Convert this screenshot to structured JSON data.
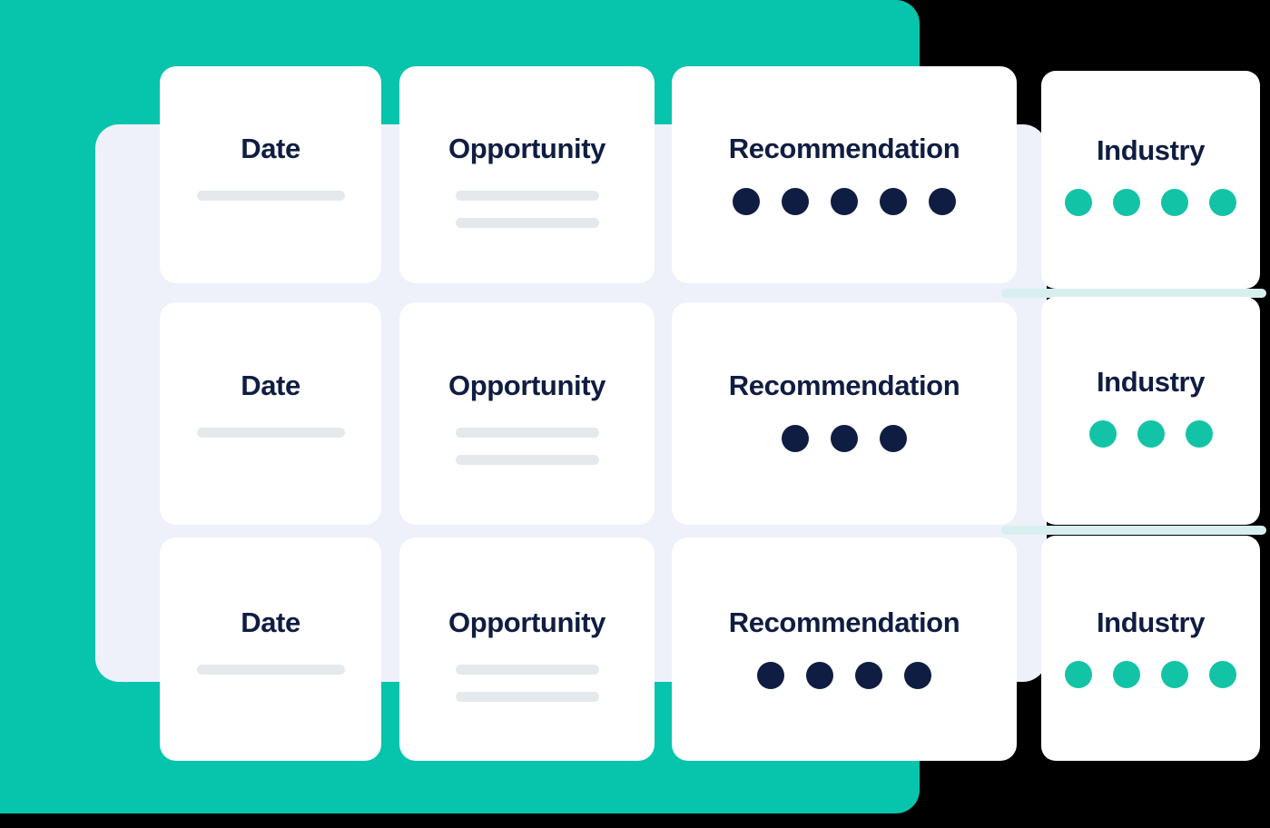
{
  "theme": {
    "page_background": "#000000",
    "panel_teal": "#07c4ad",
    "panel_lavender": "#eef1fa",
    "card_white": "#ffffff",
    "heading_navy": "#101d42",
    "dot_navy": "#101d42",
    "dot_teal": "#12c4a5",
    "skeleton_grey": "#e5e9ec",
    "rule_mint": "#d8eff0"
  },
  "columns": {
    "date": "Date",
    "opportunity": "Opportunity",
    "recommendation": "Recommendation",
    "industry": "Industry"
  },
  "rows": [
    {
      "date": {
        "label": "Date",
        "skeleton_bars": 1
      },
      "opportunity": {
        "label": "Opportunity",
        "skeleton_bars": 2
      },
      "recommendation": {
        "label": "Recommendation",
        "dots": 5,
        "dot_color": "#101d42"
      },
      "industry": {
        "label": "Industry",
        "dots": 4,
        "dot_color": "#12c4a5"
      }
    },
    {
      "date": {
        "label": "Date",
        "skeleton_bars": 1
      },
      "opportunity": {
        "label": "Opportunity",
        "skeleton_bars": 2
      },
      "recommendation": {
        "label": "Recommendation",
        "dots": 3,
        "dot_color": "#101d42"
      },
      "industry": {
        "label": "Industry",
        "dots": 3,
        "dot_color": "#12c4a5"
      }
    },
    {
      "date": {
        "label": "Date",
        "skeleton_bars": 1
      },
      "opportunity": {
        "label": "Opportunity",
        "skeleton_bars": 2
      },
      "recommendation": {
        "label": "Recommendation",
        "dots": 4,
        "dot_color": "#101d42"
      },
      "industry": {
        "label": "Industry",
        "dots": 4,
        "dot_color": "#12c4a5"
      }
    }
  ]
}
